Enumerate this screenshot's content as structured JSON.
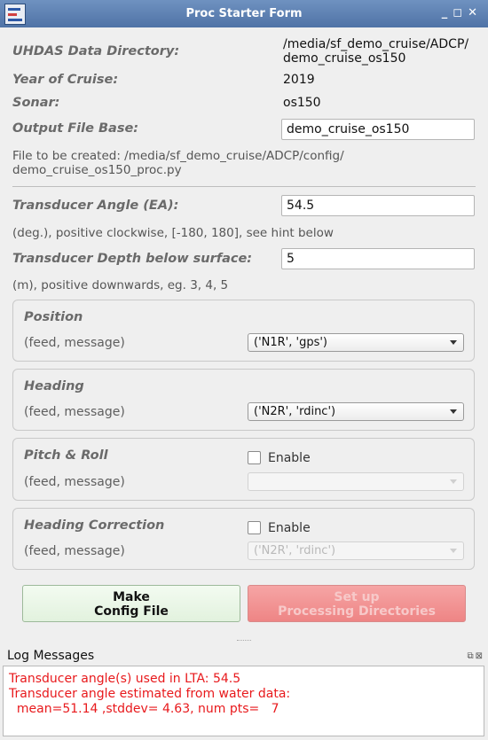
{
  "window": {
    "title": "Proc Starter Form",
    "controls": "_ ◻ ✕"
  },
  "form": {
    "data_dir_label": "UHDAS Data Directory:",
    "data_dir_value_line1": "/media/sf_demo_cruise/ADCP/",
    "data_dir_value_line2": "demo_cruise_os150",
    "year_label": "Year of Cruise:",
    "year_value": "2019",
    "sonar_label": "Sonar:",
    "sonar_value": "os150",
    "output_base_label": "Output File Base:",
    "output_base_value": "demo_cruise_os150",
    "file_created_line1": "File to be created: /media/sf_demo_cruise/ADCP/config/",
    "file_created_line2": "demo_cruise_os150_proc.py",
    "transducer_angle_label": "Transducer Angle (EA):",
    "transducer_angle_value": "54.5",
    "transducer_angle_hint": "(deg.), positive clockwise, [-180, 180], see hint below",
    "transducer_depth_label": "Transducer Depth below surface:",
    "transducer_depth_value": "5",
    "transducer_depth_hint": "(m), positive downwards, eg. 3, 4, 5"
  },
  "groups": {
    "position": {
      "title": "Position",
      "sub": "(feed, message)",
      "selected": "('N1R', 'gps')"
    },
    "heading": {
      "title": "Heading",
      "sub": "(feed, message)",
      "selected": "('N2R', 'rdinc')"
    },
    "pitch_roll": {
      "title": "Pitch & Roll",
      "sub": "(feed, message)",
      "enable_label": "Enable",
      "enabled": false,
      "selected": ""
    },
    "heading_correction": {
      "title": "Heading Correction",
      "sub": "(feed, message)",
      "enable_label": "Enable",
      "enabled": false,
      "selected": "('N2R', 'rdinc')"
    }
  },
  "buttons": {
    "make_config_line1": "Make",
    "make_config_line2": "Config File",
    "setup_line1": "Set up",
    "setup_line2": "Processing Directories"
  },
  "log": {
    "title": "Log Messages",
    "lines": [
      "Transducer angle(s) used in LTA: 54.5",
      "Transducer angle estimated from water data:",
      "  mean=51.14 ,stddev= 4.63, num pts=   7"
    ]
  },
  "colors": {
    "titlebar": "#5a7db0",
    "make_button": "#e8f5e4",
    "setup_button": "#f28e8e",
    "log_text": "#e8191c"
  }
}
